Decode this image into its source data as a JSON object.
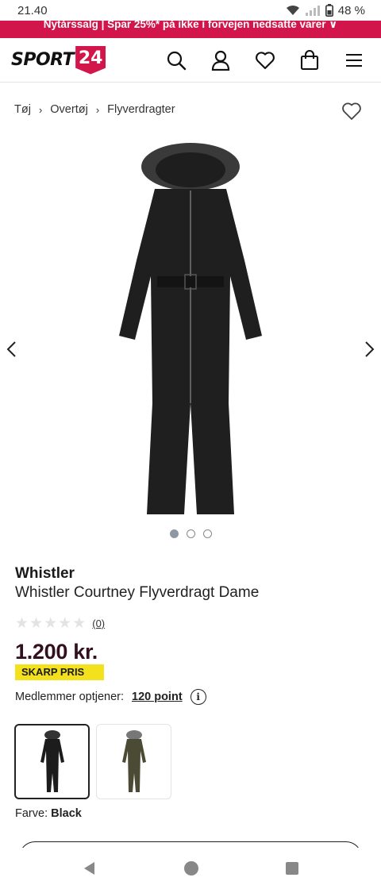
{
  "status": {
    "time": "21.40",
    "battery": "48 %"
  },
  "promo": {
    "text": "Nytårssalg | Spar 25%* på ikke i forvejen nedsatte varer"
  },
  "logo": {
    "word": "SPORT",
    "number": "24"
  },
  "breadcrumb": {
    "items": [
      "Tøj",
      "Overtøj",
      "Flyverdragter"
    ]
  },
  "gallery": {
    "slide_count": 3,
    "active_index": 0
  },
  "product": {
    "brand": "Whistler",
    "name": "Whistler Courtney Flyverdragt Dame",
    "rating_count": "(0)",
    "rating_value": 0,
    "price": "1.200 kr.",
    "badge": "SKARP PRIS",
    "members_label": "Medlemmer optjener:",
    "points": "120 point",
    "color_label": "Farve:",
    "color_value": "Black"
  },
  "variants": [
    {
      "color": "#1c1c1c",
      "selected": true
    },
    {
      "color": "#4b4a34",
      "selected": false
    }
  ],
  "colors": {
    "brand": "#d2154a",
    "badge": "#f4e11d",
    "price": "#33101f"
  }
}
